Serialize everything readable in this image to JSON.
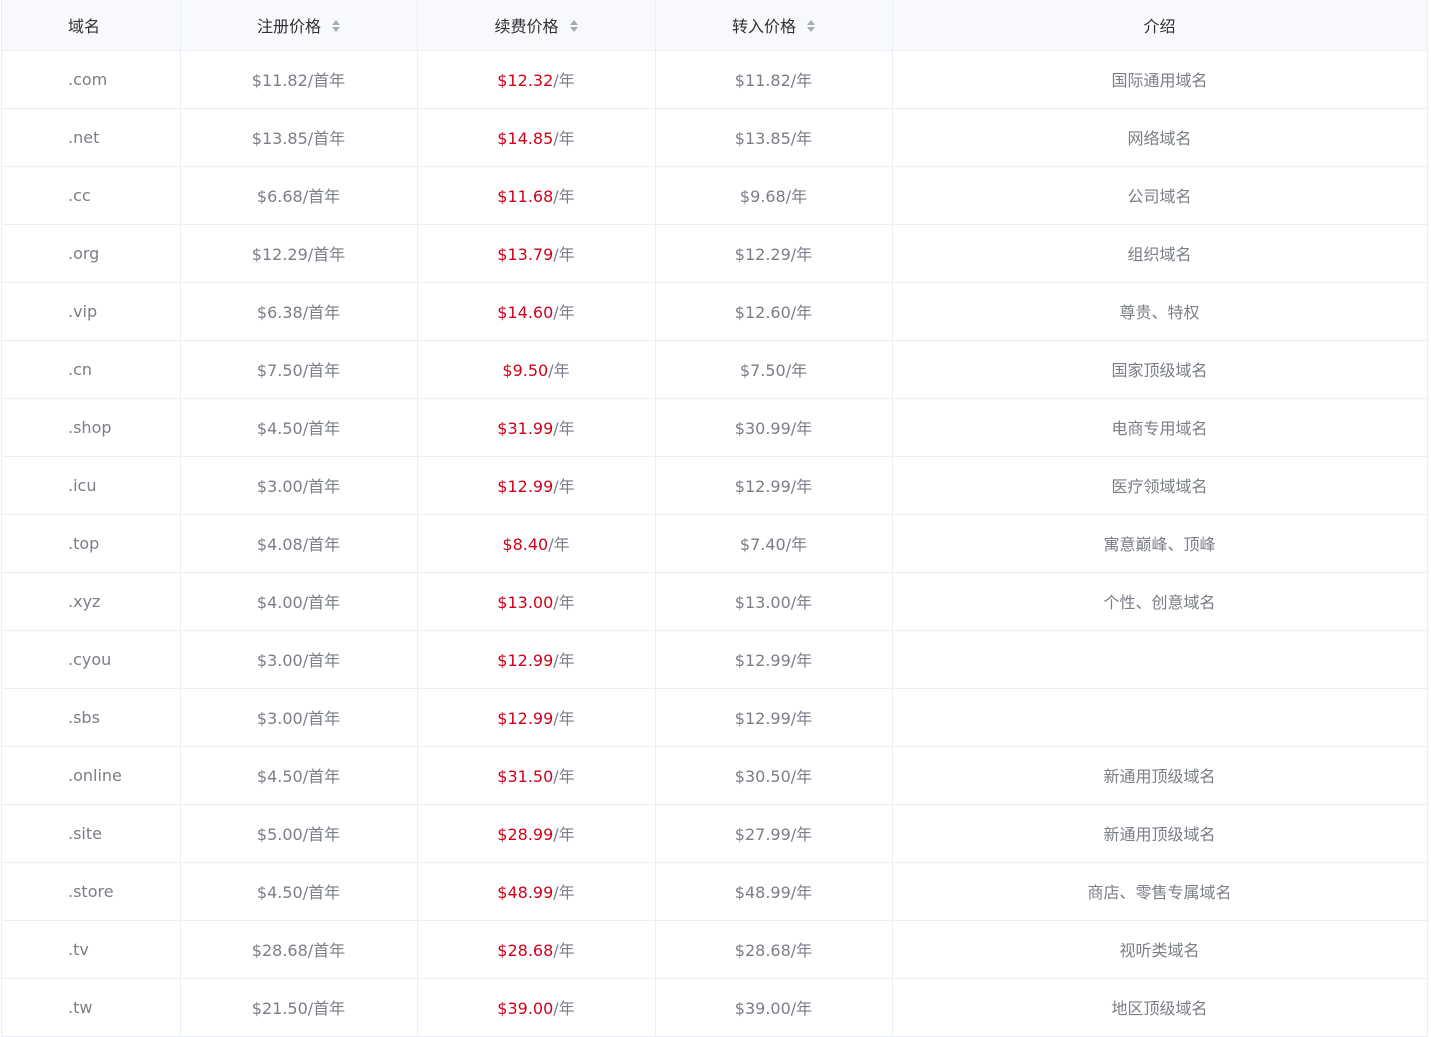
{
  "table": {
    "headers": {
      "domain": "域名",
      "register": "注册价格",
      "renew": "续费价格",
      "transfer": "转入价格",
      "intro": "介绍"
    },
    "rows": [
      {
        "domain": ".com",
        "register": "$11.82/首年",
        "renew_price": "$12.32",
        "renew_unit": "/年",
        "transfer": "$11.82/年",
        "intro": "国际通用域名"
      },
      {
        "domain": ".net",
        "register": "$13.85/首年",
        "renew_price": "$14.85",
        "renew_unit": "/年",
        "transfer": "$13.85/年",
        "intro": "网络域名"
      },
      {
        "domain": ".cc",
        "register": "$6.68/首年",
        "renew_price": "$11.68",
        "renew_unit": "/年",
        "transfer": "$9.68/年",
        "intro": "公司域名"
      },
      {
        "domain": ".org",
        "register": "$12.29/首年",
        "renew_price": "$13.79",
        "renew_unit": "/年",
        "transfer": "$12.29/年",
        "intro": "组织域名"
      },
      {
        "domain": ".vip",
        "register": "$6.38/首年",
        "renew_price": "$14.60",
        "renew_unit": "/年",
        "transfer": "$12.60/年",
        "intro": "尊贵、特权"
      },
      {
        "domain": ".cn",
        "register": "$7.50/首年",
        "renew_price": "$9.50",
        "renew_unit": "/年",
        "transfer": "$7.50/年",
        "intro": "国家顶级域名"
      },
      {
        "domain": ".shop",
        "register": "$4.50/首年",
        "renew_price": "$31.99",
        "renew_unit": "/年",
        "transfer": "$30.99/年",
        "intro": "电商专用域名"
      },
      {
        "domain": ".icu",
        "register": "$3.00/首年",
        "renew_price": "$12.99",
        "renew_unit": "/年",
        "transfer": "$12.99/年",
        "intro": "医疗领域域名"
      },
      {
        "domain": ".top",
        "register": "$4.08/首年",
        "renew_price": "$8.40",
        "renew_unit": "/年",
        "transfer": "$7.40/年",
        "intro": "寓意巅峰、顶峰"
      },
      {
        "domain": ".xyz",
        "register": "$4.00/首年",
        "renew_price": "$13.00",
        "renew_unit": "/年",
        "transfer": "$13.00/年",
        "intro": "个性、创意域名"
      },
      {
        "domain": ".cyou",
        "register": "$3.00/首年",
        "renew_price": "$12.99",
        "renew_unit": "/年",
        "transfer": "$12.99/年",
        "intro": ""
      },
      {
        "domain": ".sbs",
        "register": "$3.00/首年",
        "renew_price": "$12.99",
        "renew_unit": "/年",
        "transfer": "$12.99/年",
        "intro": ""
      },
      {
        "domain": ".online",
        "register": "$4.50/首年",
        "renew_price": "$31.50",
        "renew_unit": "/年",
        "transfer": "$30.50/年",
        "intro": "新通用顶级域名"
      },
      {
        "domain": ".site",
        "register": "$5.00/首年",
        "renew_price": "$28.99",
        "renew_unit": "/年",
        "transfer": "$27.99/年",
        "intro": "新通用顶级域名"
      },
      {
        "domain": ".store",
        "register": "$4.50/首年",
        "renew_price": "$48.99",
        "renew_unit": "/年",
        "transfer": "$48.99/年",
        "intro": "商店、零售专属域名"
      },
      {
        "domain": ".tv",
        "register": "$28.68/首年",
        "renew_price": "$28.68",
        "renew_unit": "/年",
        "transfer": "$28.68/年",
        "intro": "视听类域名"
      },
      {
        "domain": ".tw",
        "register": "$21.50/首年",
        "renew_price": "$39.00",
        "renew_unit": "/年",
        "transfer": "$39.00/年",
        "intro": "地区顶级域名"
      }
    ]
  },
  "colors": {
    "renew_price": "#d0021b",
    "header_bg": "#f8f9fc",
    "border": "#ebeef5"
  }
}
